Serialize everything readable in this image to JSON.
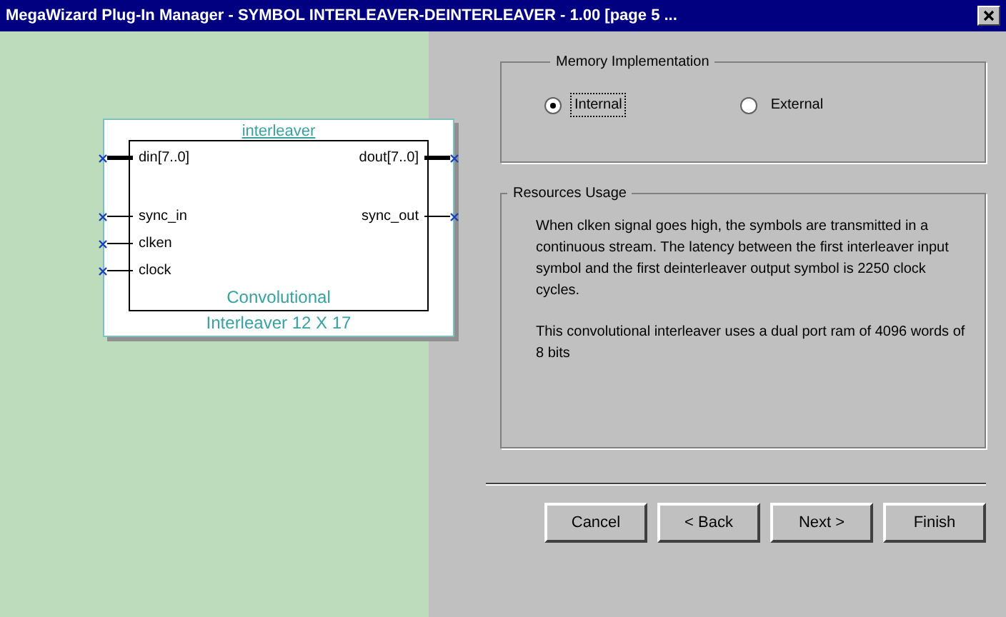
{
  "window": {
    "title": "MegaWizard Plug-In Manager - SYMBOL INTERLEAVER-DEINTERLEAVER - 1.00 [page 5 ..."
  },
  "symbol": {
    "name": "interleaver",
    "inputs": [
      {
        "label": "din[7..0]",
        "kind": "bus"
      },
      {
        "label": "sync_in",
        "kind": "wire"
      },
      {
        "label": "clken",
        "kind": "wire"
      },
      {
        "label": "clock",
        "kind": "wire"
      }
    ],
    "outputs": [
      {
        "label": "dout[7..0]",
        "kind": "bus"
      },
      {
        "label": "sync_out",
        "kind": "wire"
      }
    ],
    "caption_lines": [
      "Convolutional",
      "Interleaver 12 X 17"
    ]
  },
  "memory_implementation": {
    "title": "Memory Implementation",
    "options": [
      {
        "label": "Internal",
        "selected": true,
        "focused": true
      },
      {
        "label": "External",
        "selected": false,
        "focused": false
      }
    ]
  },
  "resources_usage": {
    "title": "Resources Usage",
    "paragraphs": [
      "When clken signal goes high, the symbols are transmitted in a continuous stream. The latency between the first interleaver input symbol and the first deinterleaver output symbol is 2250 clock cycles.",
      "This convolutional interleaver uses a dual port ram of 4096 words of 8 bits"
    ]
  },
  "buttons": [
    "Cancel",
    "< Back",
    "Next >",
    "Finish"
  ]
}
